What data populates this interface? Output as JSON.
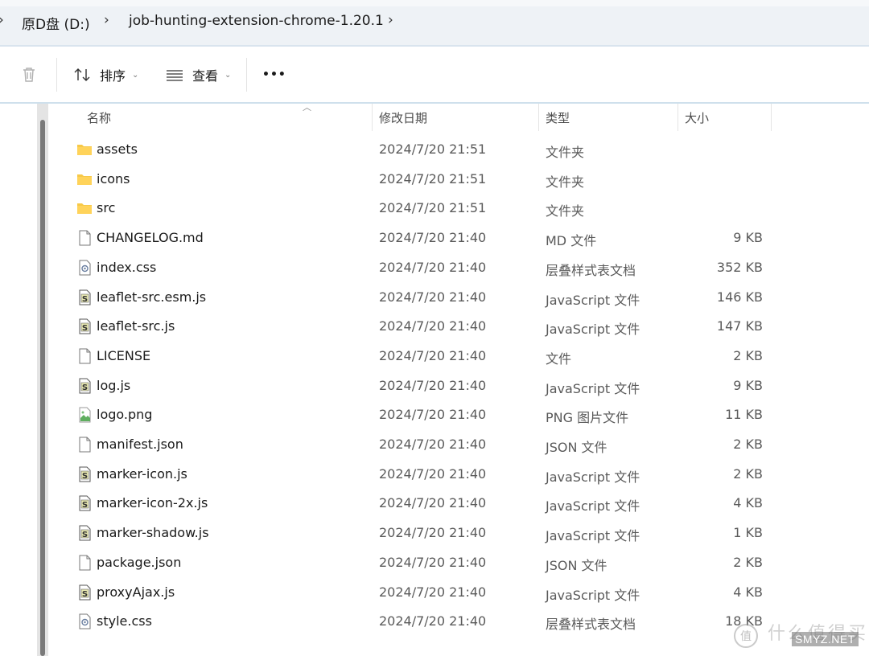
{
  "breadcrumb": {
    "items": [
      "原D盘 (D:)",
      "job-hunting-extension-chrome-1.20.1"
    ]
  },
  "toolbar": {
    "sort_label": "排序",
    "view_label": "查看",
    "more_label": "•••"
  },
  "columns": {
    "name": "名称",
    "date": "修改日期",
    "type": "类型",
    "size": "大小"
  },
  "files": [
    {
      "name": "assets",
      "date": "2024/7/20 21:51",
      "type": "文件夹",
      "size": "",
      "icon": "folder-icon"
    },
    {
      "name": "icons",
      "date": "2024/7/20 21:51",
      "type": "文件夹",
      "size": "",
      "icon": "folder-icon"
    },
    {
      "name": "src",
      "date": "2024/7/20 21:51",
      "type": "文件夹",
      "size": "",
      "icon": "folder-icon"
    },
    {
      "name": "CHANGELOG.md",
      "date": "2024/7/20 21:40",
      "type": "MD 文件",
      "size": "9 KB",
      "icon": "file-icon"
    },
    {
      "name": "index.css",
      "date": "2024/7/20 21:40",
      "type": "层叠样式表文档",
      "size": "352 KB",
      "icon": "css-file-icon"
    },
    {
      "name": "leaflet-src.esm.js",
      "date": "2024/7/20 21:40",
      "type": "JavaScript 文件",
      "size": "146 KB",
      "icon": "js-file-icon"
    },
    {
      "name": "leaflet-src.js",
      "date": "2024/7/20 21:40",
      "type": "JavaScript 文件",
      "size": "147 KB",
      "icon": "js-file-icon"
    },
    {
      "name": "LICENSE",
      "date": "2024/7/20 21:40",
      "type": "文件",
      "size": "2 KB",
      "icon": "file-icon"
    },
    {
      "name": "log.js",
      "date": "2024/7/20 21:40",
      "type": "JavaScript 文件",
      "size": "9 KB",
      "icon": "js-file-icon"
    },
    {
      "name": "logo.png",
      "date": "2024/7/20 21:40",
      "type": "PNG 图片文件",
      "size": "11 KB",
      "icon": "image-file-icon"
    },
    {
      "name": "manifest.json",
      "date": "2024/7/20 21:40",
      "type": "JSON 文件",
      "size": "2 KB",
      "icon": "file-icon"
    },
    {
      "name": "marker-icon.js",
      "date": "2024/7/20 21:40",
      "type": "JavaScript 文件",
      "size": "2 KB",
      "icon": "js-file-icon"
    },
    {
      "name": "marker-icon-2x.js",
      "date": "2024/7/20 21:40",
      "type": "JavaScript 文件",
      "size": "4 KB",
      "icon": "js-file-icon"
    },
    {
      "name": "marker-shadow.js",
      "date": "2024/7/20 21:40",
      "type": "JavaScript 文件",
      "size": "1 KB",
      "icon": "js-file-icon"
    },
    {
      "name": "package.json",
      "date": "2024/7/20 21:40",
      "type": "JSON 文件",
      "size": "2 KB",
      "icon": "file-icon"
    },
    {
      "name": "proxyAjax.js",
      "date": "2024/7/20 21:40",
      "type": "JavaScript 文件",
      "size": "4 KB",
      "icon": "js-file-icon"
    },
    {
      "name": "style.css",
      "date": "2024/7/20 21:40",
      "type": "层叠样式表文档",
      "size": "18 KB",
      "icon": "css-file-icon"
    }
  ],
  "watermark": {
    "cn_text": "什么值得买",
    "site": "SMYZ.NET"
  },
  "colors": {
    "folder": "#f7c948",
    "accent_border": "#cfe0ec",
    "breadcrumb_bg": "#eef2f6"
  }
}
